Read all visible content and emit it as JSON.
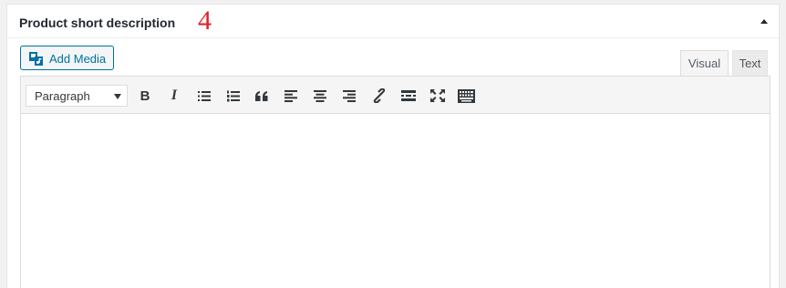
{
  "postbox": {
    "title": "Product short description",
    "annotation": "4"
  },
  "editor": {
    "add_media_label": "Add Media",
    "tabs": [
      {
        "label": "Visual",
        "active": true
      },
      {
        "label": "Text",
        "active": false
      }
    ],
    "format_select": "Paragraph",
    "toolbar_buttons": [
      {
        "name": "bold",
        "label": "B"
      },
      {
        "name": "italic",
        "label": "I"
      },
      {
        "name": "bulleted-list",
        "icon": "bulleted-list-icon"
      },
      {
        "name": "numbered-list",
        "icon": "numbered-list-icon"
      },
      {
        "name": "blockquote",
        "icon": "blockquote-icon"
      },
      {
        "name": "align-left",
        "icon": "align-left-icon"
      },
      {
        "name": "align-center",
        "icon": "align-center-icon"
      },
      {
        "name": "align-right",
        "icon": "align-right-icon"
      },
      {
        "name": "insert-link",
        "icon": "link-icon"
      },
      {
        "name": "read-more",
        "icon": "read-more-icon"
      },
      {
        "name": "fullscreen",
        "icon": "fullscreen-icon"
      },
      {
        "name": "toolbar-toggle",
        "icon": "keyboard-icon"
      }
    ],
    "content": ""
  },
  "colors": {
    "accent": "#0071a1",
    "annotation": "#e0242b",
    "icon": "#32373c"
  }
}
